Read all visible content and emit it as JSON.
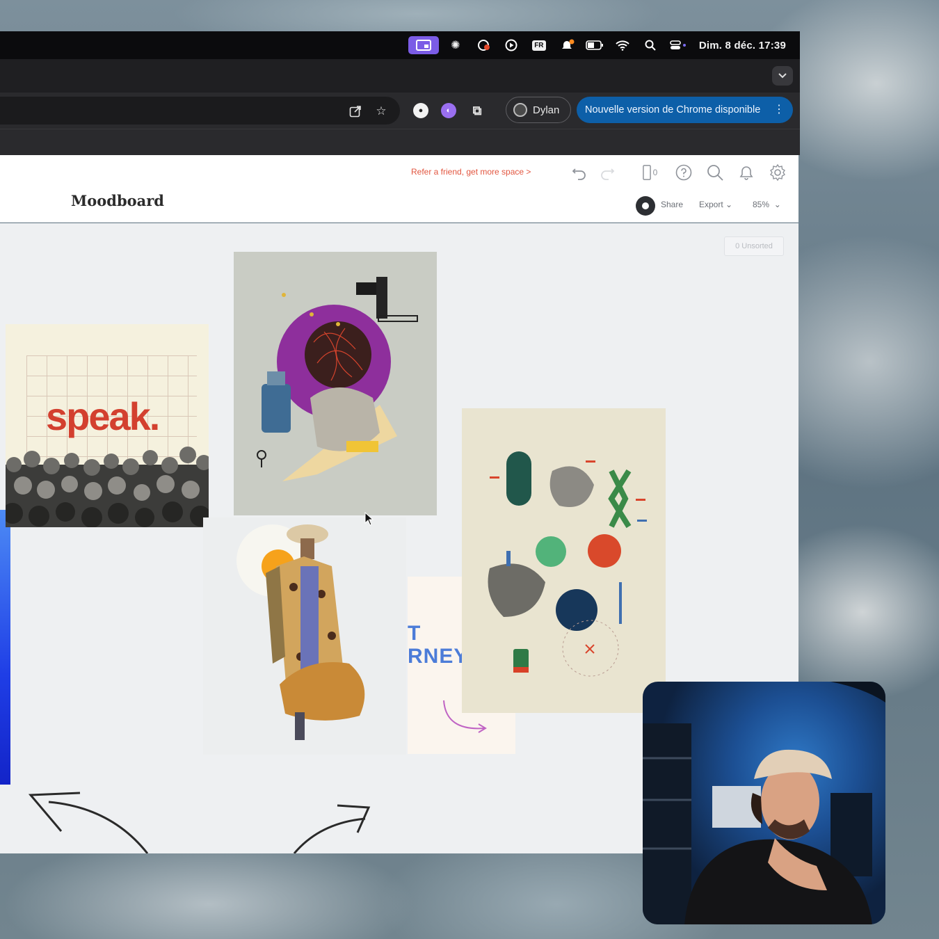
{
  "menubar": {
    "input_source": "FR",
    "clock": "Dim. 8 déc.  17:39"
  },
  "toolbar": {
    "profile_name": "Dylan",
    "update_label": "Nouvelle version de Chrome disponible"
  },
  "app": {
    "refer_link": "Refer a friend, get more space >",
    "device_count": "0",
    "board_title": "Moodboard",
    "share_label": "Share",
    "export_label": "Export",
    "zoom_label": "85%",
    "unsorted_label": "0 Unsorted"
  },
  "canvas": {
    "speak_word": "speak.",
    "journey_line1": "T",
    "journey_line2": "RNEY"
  },
  "colors": {
    "menubar_bg": "#0b0b0d",
    "update_chip": "#0d5fa8",
    "refer_link": "#e2553f",
    "canvas_bg": "#eef0f2",
    "speak_red": "#d3402f"
  }
}
